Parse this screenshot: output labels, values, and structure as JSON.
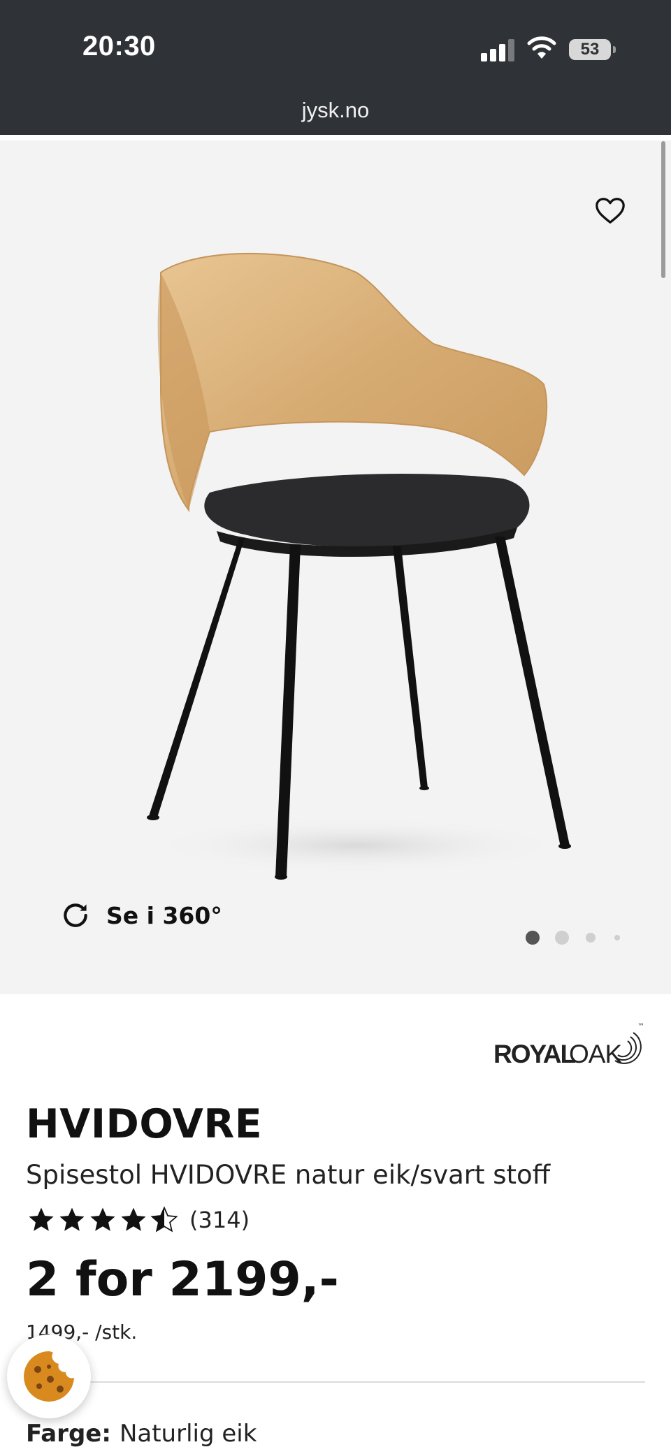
{
  "status_bar": {
    "time": "20:30",
    "battery": "53",
    "icons": [
      "signal-icon",
      "wifi-icon",
      "battery-icon"
    ]
  },
  "browser": {
    "url": "jysk.no"
  },
  "gallery": {
    "view360_label": "Se i 360°",
    "total_images": 4,
    "active_index": 0,
    "icons": [
      "heart-icon",
      "rotate-icon"
    ]
  },
  "product": {
    "brand": "ROYAL OAK",
    "brand_part1": "ROYAL",
    "brand_part2": "OAK",
    "name": "HVIDOVRE",
    "description": "Spisestol HVIDOVRE natur eik/svart stoff",
    "rating": 4.5,
    "rating_max": 5,
    "review_count": "(314)",
    "price": "2 for 2199,-",
    "unit_price": "1499,- /stk.",
    "color_label": "Farge:",
    "color_value": "Naturlig eik"
  },
  "colors": {
    "header_bg": "#2f3236",
    "gallery_bg": "#f3f3f3",
    "text": "#111111"
  }
}
